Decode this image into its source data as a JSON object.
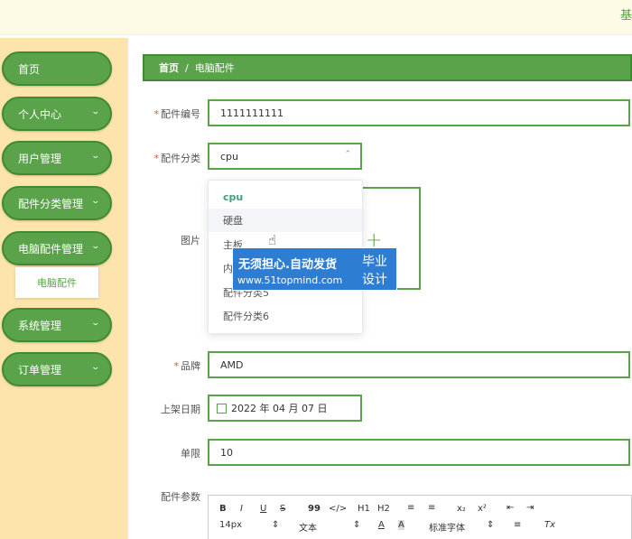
{
  "topbar": {
    "char": "基"
  },
  "sidebar": {
    "items": [
      {
        "label": "首页",
        "has_chevron": false
      },
      {
        "label": "个人中心",
        "has_chevron": true
      },
      {
        "label": "用户管理",
        "has_chevron": true
      },
      {
        "label": "配件分类管理",
        "has_chevron": true
      },
      {
        "label": "电脑配件管理",
        "has_chevron": true,
        "expanded": true
      },
      {
        "label": "系统管理",
        "has_chevron": true
      },
      {
        "label": "订单管理",
        "has_chevron": true
      }
    ],
    "subitem": "电脑配件",
    "chevron": "⌄"
  },
  "breadcrumb": {
    "home": "首页",
    "separator": "/",
    "current": "电脑配件"
  },
  "form": {
    "required_mark": "*",
    "part_no": {
      "label": "配件编号",
      "value": "1111111111"
    },
    "category": {
      "label": "配件分类",
      "value": "cpu",
      "arrow": "⌃"
    },
    "image": {
      "label": "图片",
      "plus": "+"
    },
    "brand": {
      "label": "品牌",
      "value": "AMD"
    },
    "date": {
      "label": "上架日期",
      "value": "2022 年 04 月 07 日"
    },
    "limit": {
      "label": "单限",
      "value": "10"
    },
    "params": {
      "label": "配件参数"
    }
  },
  "dropdown": {
    "options": [
      "cpu",
      "硬盘",
      "主板",
      "内",
      "配件分类5",
      "配件分类6"
    ],
    "selected": "cpu",
    "hover": "硬盘"
  },
  "watermark": {
    "line1": "无须担心.自动发货",
    "line2": "www.51topmind.com",
    "line3": "毕业",
    "line4": "设计"
  },
  "editor": {
    "row1": [
      "B",
      "I",
      "U",
      "S",
      "99",
      "</>",
      "H1",
      "H2",
      "≡",
      "≡",
      "x₂",
      "x²",
      "⇤",
      "⇥"
    ],
    "size": "14px",
    "format": "文本",
    "font": "标准字体",
    "color_a": "A",
    "bg_a": "A",
    "align": "≡",
    "clear": "Tx"
  },
  "colors": {
    "accent": "#5aa34a",
    "accent_dark": "#3e8b33",
    "sidebar_bg": "#fde4ad",
    "required": "#e64b3b"
  }
}
